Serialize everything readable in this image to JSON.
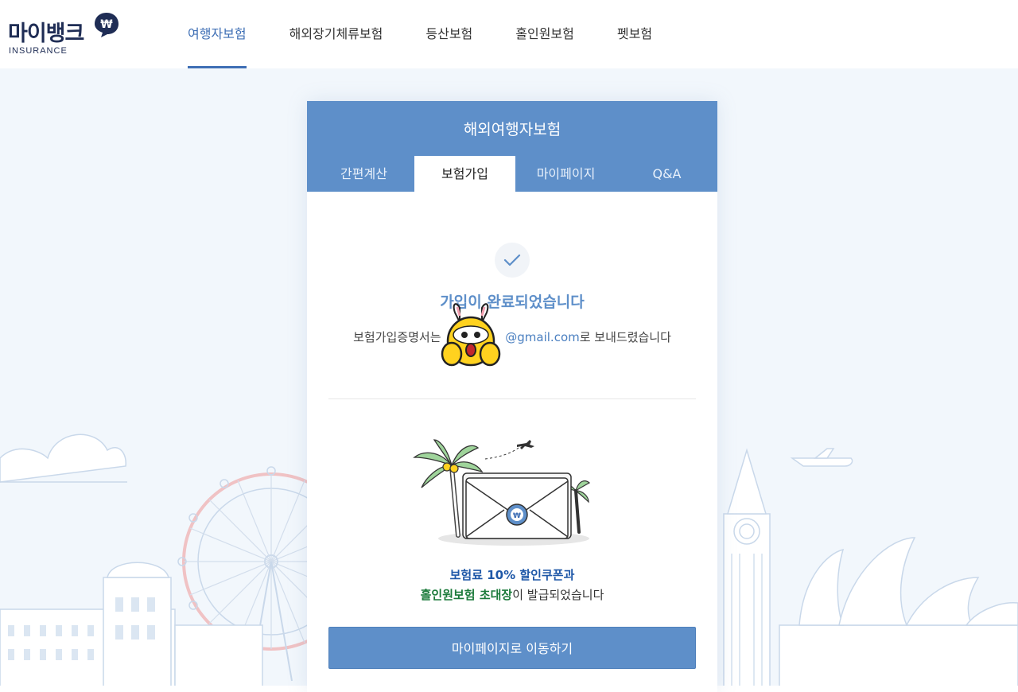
{
  "brand": {
    "name": "마이뱅크",
    "sub": "INSURANCE",
    "bubble_symbol": "₩"
  },
  "nav": {
    "items": [
      {
        "label": "여행자보험",
        "active": true
      },
      {
        "label": "해외장기체류보험",
        "active": false
      },
      {
        "label": "등산보험",
        "active": false
      },
      {
        "label": "홀인원보험",
        "active": false
      },
      {
        "label": "펫보험",
        "active": false
      }
    ]
  },
  "card": {
    "title": "해외여행자보험",
    "tabs": [
      {
        "label": "간편계산",
        "active": false
      },
      {
        "label": "보험가입",
        "active": true
      },
      {
        "label": "마이페이지",
        "active": false
      },
      {
        "label": "Q&A",
        "active": false
      }
    ],
    "check_icon": "check-icon",
    "done_title": "가입이 완료되었습니다",
    "desc_prefix": "보험가입증명서는 ",
    "email": "@gmail.com",
    "desc_suffix": "로 보내드렸습니다",
    "envelope_symbol": "₩",
    "coupon_line1": "보험료 10% 할인쿠폰과",
    "coupon_line2_highlight": "홀인원보험 초대장",
    "coupon_line2_suffix": "이 발급되었습니다",
    "cta_label": "마이페이지로 이동하기"
  },
  "colors": {
    "primary": "#5e8fc9",
    "nav_active": "#3f6fb5",
    "green": "#1b7a3a",
    "brand_navy": "#1f2d55"
  }
}
